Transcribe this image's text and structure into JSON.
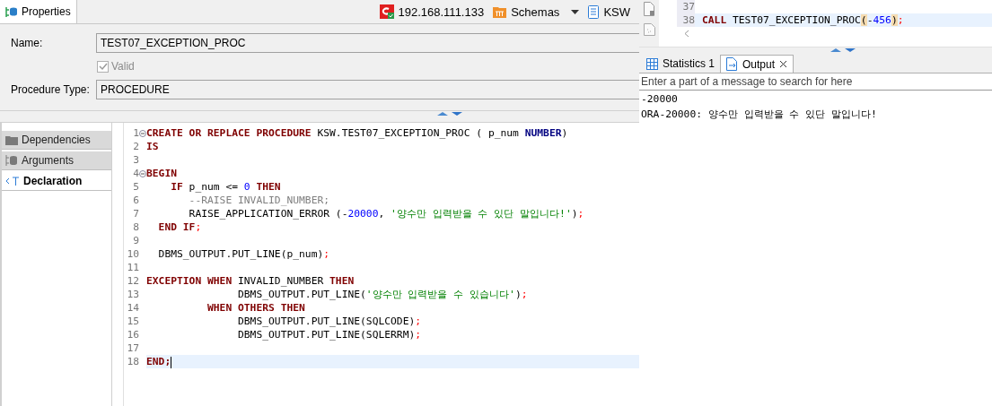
{
  "properties_tab": {
    "label": "Properties",
    "selected": true
  },
  "toolbar": {
    "connection": "192.168.111.133",
    "schemas": "Schemas",
    "schema": "KSW"
  },
  "form": {
    "name_label": "Name:",
    "name_value": "TEST07_EXCEPTION_PROC",
    "valid": {
      "label": "Valid",
      "checked": true,
      "disabled": true
    },
    "type_label": "Procedure Type:",
    "type_value": "PROCEDURE"
  },
  "side_tabs": [
    {
      "label": "Dependencies",
      "selected": false
    },
    {
      "label": "Arguments",
      "selected": false
    },
    {
      "label": "Declaration",
      "selected": true
    }
  ],
  "editor": {
    "lines": [
      {
        "number": "1",
        "fold": true,
        "current": false,
        "tokens": [
          {
            "kind": "keyword",
            "text": "CREATE OR REPLACE PROCEDURE"
          },
          {
            "kind": "plain",
            "text": " KSW.TEST07_EXCEPTION_PROC ( p_num "
          },
          {
            "kind": "type",
            "text": "NUMBER"
          },
          {
            "kind": "plain",
            "text": ")"
          }
        ]
      },
      {
        "number": "2",
        "fold": false,
        "current": false,
        "tokens": [
          {
            "kind": "keyword",
            "text": "IS"
          }
        ]
      },
      {
        "number": "3",
        "fold": false,
        "current": false
      },
      {
        "number": "4",
        "fold": true,
        "current": false,
        "tokens": [
          {
            "kind": "keyword",
            "text": "BEGIN"
          }
        ]
      },
      {
        "number": "5",
        "fold": false,
        "current": false,
        "tokens": [
          {
            "kind": "keyword",
            "text": "    IF"
          },
          {
            "kind": "plain",
            "text": " p_num <= "
          },
          {
            "kind": "number",
            "text": "0"
          },
          {
            "kind": "keyword",
            "text": " THEN"
          }
        ]
      },
      {
        "number": "6",
        "fold": false,
        "current": false,
        "tokens": [
          {
            "kind": "comment",
            "text": "       --RAISE INVALID_NUMBER;"
          }
        ]
      },
      {
        "number": "7",
        "fold": false,
        "current": false,
        "tokens": [
          {
            "kind": "plain",
            "text": "       RAISE_APPLICATION_ERROR (-"
          },
          {
            "kind": "number",
            "text": "20000"
          },
          {
            "kind": "plain",
            "text": ", "
          },
          {
            "kind": "string",
            "text": "'양수만 입력받을 수 있단 말입니다!'"
          },
          {
            "kind": "plain",
            "text": ")"
          },
          {
            "kind": "semicolon",
            "text": ";"
          }
        ]
      },
      {
        "number": "8",
        "fold": false,
        "current": false,
        "tokens": [
          {
            "kind": "keyword",
            "text": "  END IF"
          },
          {
            "kind": "semicolon",
            "text": ";"
          }
        ]
      },
      {
        "number": "9",
        "fold": false,
        "current": false
      },
      {
        "number": "10",
        "fold": false,
        "current": false,
        "tokens": [
          {
            "kind": "plain",
            "text": "  DBMS_OUTPUT.PUT_LINE(p_num)"
          },
          {
            "kind": "semicolon",
            "text": ";"
          }
        ]
      },
      {
        "number": "11",
        "fold": false,
        "current": false
      },
      {
        "number": "12",
        "fold": false,
        "current": false,
        "tokens": [
          {
            "kind": "keyword",
            "text": "EXCEPTION WHEN"
          },
          {
            "kind": "plain",
            "text": " INVALID_NUMBER "
          },
          {
            "kind": "keyword",
            "text": "THEN"
          }
        ]
      },
      {
        "number": "13",
        "fold": false,
        "current": false,
        "tokens": [
          {
            "kind": "plain",
            "text": "               DBMS_OUTPUT.PUT_LINE("
          },
          {
            "kind": "string",
            "text": "'양수만 입력받을 수 있습니다'"
          },
          {
            "kind": "plain",
            "text": ")"
          },
          {
            "kind": "semicolon",
            "text": ";"
          }
        ]
      },
      {
        "number": "14",
        "fold": false,
        "current": false,
        "tokens": [
          {
            "kind": "keyword",
            "text": "          WHEN OTHERS THEN"
          }
        ]
      },
      {
        "number": "15",
        "fold": false,
        "current": false,
        "tokens": [
          {
            "kind": "plain",
            "text": "               DBMS_OUTPUT.PUT_LINE(SQLCODE)"
          },
          {
            "kind": "semicolon",
            "text": ";"
          }
        ]
      },
      {
        "number": "16",
        "fold": false,
        "current": false,
        "tokens": [
          {
            "kind": "plain",
            "text": "               DBMS_OUTPUT.PUT_LINE(SQLERRM)"
          },
          {
            "kind": "semicolon",
            "text": ";"
          }
        ]
      },
      {
        "number": "17",
        "fold": false,
        "current": false
      },
      {
        "number": "18",
        "fold": false,
        "current": true,
        "tokens": [
          {
            "kind": "keyword",
            "text": "END;"
          }
        ]
      }
    ]
  },
  "sql_editor": {
    "lines": [
      {
        "number": "37",
        "current": false
      },
      {
        "number": "38",
        "current": true,
        "tokens": [
          {
            "kind": "keyword",
            "text": "CALL"
          },
          {
            "kind": "plain",
            "text": " TEST07_EXCEPTION_PROC"
          },
          {
            "kind": "bracket",
            "text": "("
          },
          {
            "kind": "plain",
            "text": "-"
          },
          {
            "kind": "number",
            "text": "456"
          },
          {
            "kind": "bracket",
            "text": ")"
          },
          {
            "kind": "semicolon",
            "text": ";"
          }
        ]
      }
    ]
  },
  "output_tabs": [
    {
      "label": "Statistics 1",
      "selected": false,
      "closable": false
    },
    {
      "label": "Output",
      "selected": true,
      "closable": true
    }
  ],
  "output": {
    "placeholder": "Enter a part of a message to search for here",
    "lines": [
      "-20000",
      "ORA-20000: 양수만 입력받을 수 있단 말입니다!"
    ]
  }
}
